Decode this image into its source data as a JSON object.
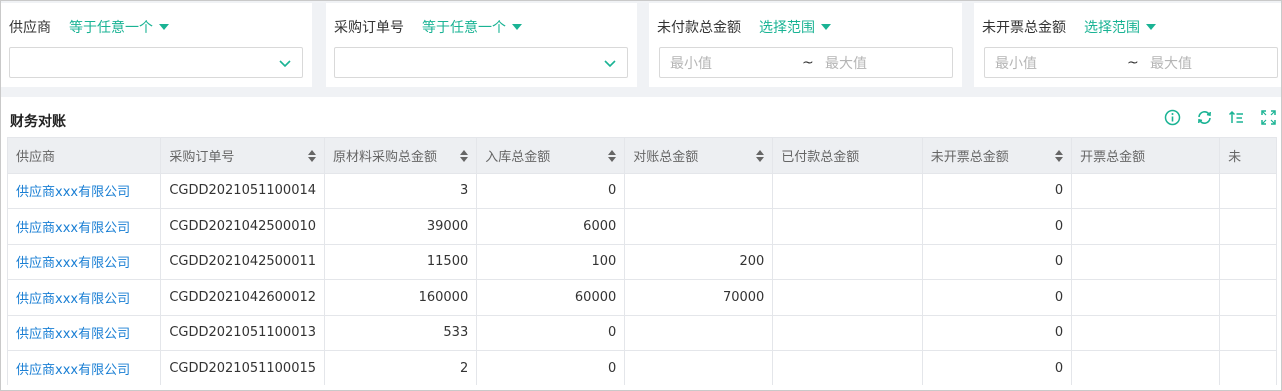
{
  "filters": [
    {
      "label": "供应商",
      "operator": "等于任意一个",
      "type": "select",
      "value": ""
    },
    {
      "label": "采购订单号",
      "operator": "等于任意一个",
      "type": "select",
      "value": ""
    },
    {
      "label": "未付款总金额",
      "operator": "选择范围",
      "type": "range",
      "min_placeholder": "最小值",
      "separator": "~",
      "max_placeholder": "最大值"
    },
    {
      "label": "未开票总金额",
      "operator": "选择范围",
      "type": "range",
      "min_placeholder": "最小值",
      "separator": "~",
      "max_placeholder": "最大值"
    }
  ],
  "table": {
    "title": "财务对账",
    "tool_icons": [
      "info-icon",
      "refresh-icon",
      "sort-settings-icon",
      "fullscreen-icon"
    ],
    "columns": [
      "供应商",
      "采购订单号",
      "原材料采购总金额",
      "入库总金额",
      "对账总金额",
      "已付款总金额",
      "未开票总金额",
      "开票总金额",
      "未"
    ],
    "rows": [
      [
        "供应商xxx有限公司",
        "CGDD2021051100014",
        "3",
        "0",
        "",
        "",
        "0",
        "",
        ""
      ],
      [
        "供应商xxx有限公司",
        "CGDD2021042500010",
        "39000",
        "6000",
        "",
        "",
        "0",
        "",
        ""
      ],
      [
        "供应商xxx有限公司",
        "CGDD2021042500011",
        "11500",
        "100",
        "200",
        "",
        "0",
        "",
        ""
      ],
      [
        "供应商xxx有限公司",
        "CGDD2021042600012",
        "160000",
        "60000",
        "70000",
        "",
        "0",
        "",
        ""
      ],
      [
        "供应商xxx有限公司",
        "CGDD2021051100013",
        "533",
        "0",
        "",
        "",
        "0",
        "",
        ""
      ],
      [
        "供应商xxx有限公司",
        "CGDD2021051100015",
        "2",
        "0",
        "",
        "",
        "0",
        "",
        ""
      ]
    ]
  },
  "colors": {
    "accent": "#1ab394",
    "link": "#1a7fd4",
    "header_bg": "#edeff2"
  }
}
